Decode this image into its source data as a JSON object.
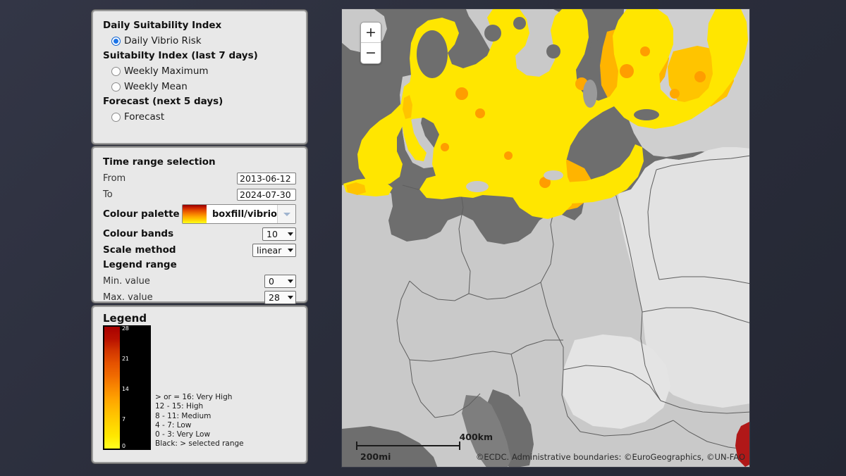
{
  "index_panel": {
    "group_daily_title": "Daily Suitability Index",
    "group_weekly_title": "Suitabilty Index (last 7 days)",
    "group_forecast_title": "Forecast (next 5 days)",
    "options": [
      {
        "label": "Daily Vibrio Risk",
        "selected": true
      },
      {
        "label": "Weekly Maximum",
        "selected": false
      },
      {
        "label": "Weekly Mean",
        "selected": false
      },
      {
        "label": "Forecast",
        "selected": false
      }
    ]
  },
  "time_panel": {
    "title": "Time range selection",
    "from_label": "From",
    "from_value": "2013-06-12",
    "to_label": "To",
    "to_value": "2024-07-30",
    "palette_label": "Colour palette",
    "palette_value": "boxfill/vibrio",
    "bands_label": "Colour bands",
    "bands_value": "10",
    "scale_label": "Scale method",
    "scale_value": "linear",
    "legend_range_label": "Legend range",
    "min_label": "Min. value",
    "min_value": "0",
    "max_label": "Max. value",
    "max_value": "28"
  },
  "legend_panel": {
    "title": "Legend",
    "ticks": [
      "28",
      "21",
      "14",
      "7",
      "0"
    ],
    "classes": [
      "> or = 16: Very High",
      "12 - 15: High",
      "8 - 11: Medium",
      "4 - 7: Low",
      "0 - 3: Very Low",
      "Black: > selected range"
    ],
    "colour_top": "#a80000",
    "colour_bottom": "#ffff20",
    "background": "#000000"
  },
  "map": {
    "zoom_in_label": "+",
    "zoom_out_label": "−",
    "scale_km": "400km",
    "scale_mi": "200mi",
    "attribution": "©ECDC. Administrative boundaries: ©EuroGeographics, ©UN-FAO",
    "sea_colour": "#6e6e6e",
    "land_colour": "#c9c9c9",
    "land_colour_alt": "#e2e2e2",
    "border_colour": "#5e5e5e",
    "data_colour_low": "#ffe600",
    "data_colour_mid": "#ffc400",
    "data_colour_high": "#ff9d00",
    "data_colour_max": "#b01818"
  }
}
